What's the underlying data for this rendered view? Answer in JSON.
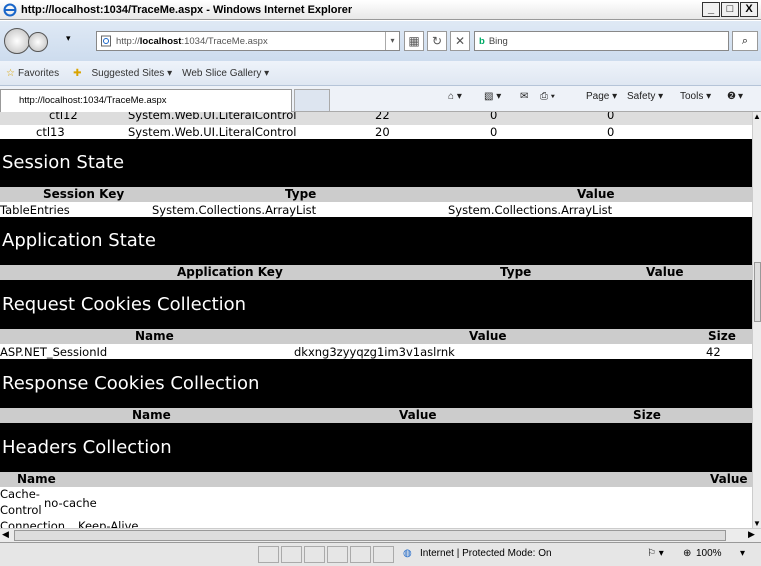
{
  "window": {
    "title": "http://localhost:1034/TraceMe.aspx - Windows Internet Explorer",
    "min": "_",
    "max": "□",
    "close": "X"
  },
  "nav": {
    "url_prefix": "http://",
    "url_host": "localhost",
    "url_rest": ":1034/TraceMe.aspx",
    "search_placeholder": "Bing",
    "refresh": "↻",
    "stop": "✕"
  },
  "favorites": {
    "favorites": "Favorites",
    "suggested": "Suggested Sites ▾",
    "webslice": "Web Slice Gallery ▾"
  },
  "tab": {
    "title": "http://localhost:1034/TraceMe.aspx"
  },
  "commands": {
    "page": "Page ▾",
    "safety": "Safety ▾",
    "tools": "Tools ▾",
    "help": "▾"
  },
  "control_rows": [
    {
      "id": "ctl12",
      "type": "System.Web.UI.LiteralControl",
      "render": "22",
      "vs": "0",
      "cs": "0"
    },
    {
      "id": "ctl13",
      "type": "System.Web.UI.LiteralControl",
      "render": "20",
      "vs": "0",
      "cs": "0"
    }
  ],
  "session": {
    "title": "Session State",
    "h_key": "Session Key",
    "h_type": "Type",
    "h_value": "Value",
    "rows": [
      {
        "key": "TableEntries",
        "type": "System.Collections.ArrayList",
        "value": "System.Collections.ArrayList"
      }
    ]
  },
  "application": {
    "title": "Application State",
    "h_key": "Application Key",
    "h_type": "Type",
    "h_value": "Value"
  },
  "req_cookies": {
    "title": "Request Cookies Collection",
    "h_name": "Name",
    "h_value": "Value",
    "h_size": "Size",
    "rows": [
      {
        "name": "ASP.NET_SessionId",
        "value": "dkxng3zyyqzg1im3v1aslrnk",
        "size": "42"
      }
    ]
  },
  "resp_cookies": {
    "title": "Response Cookies Collection",
    "h_name": "Name",
    "h_value": "Value",
    "h_size": "Size"
  },
  "headers": {
    "title": "Headers Collection",
    "h_name": "Name",
    "h_value": "Value",
    "rows": [
      {
        "name1": "Cache-",
        "name2": "Control",
        "value": "no-cache"
      },
      {
        "name": "Connection",
        "value": "Keep-Alive"
      }
    ]
  },
  "status": {
    "zone": "Internet | Protected Mode: On",
    "zoom": "100%"
  }
}
